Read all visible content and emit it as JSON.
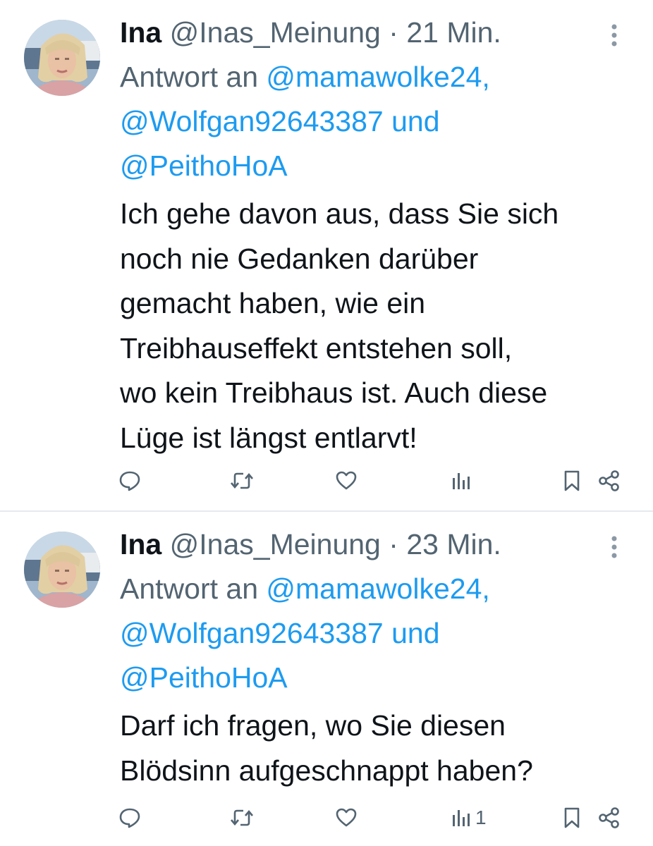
{
  "tweets": [
    {
      "name": "Ina",
      "handle": "@Inas_Meinung",
      "separator": "·",
      "time": "21 Min.",
      "reply_prefix": "Antwort an",
      "mention_1": "@mamawolke24,",
      "mention_2": "@Wolfgan92643387",
      "reply_join": "und",
      "mention_3": "@PeithoHoA",
      "text_lines": [
        "Ich gehe davon aus, dass Sie sich",
        "noch nie Gedanken darüber",
        "gemacht haben, wie ein",
        "Treibhauseffekt entstehen soll,",
        "wo kein Treibhaus ist. Auch diese",
        "Lüge ist längst entlarvt!"
      ],
      "actions": {
        "reply_icon": "reply-icon",
        "retweet_icon": "retweet-icon",
        "like_icon": "heart-icon",
        "views_icon": "views-icon",
        "views_count": "",
        "bookmark_icon": "bookmark-icon",
        "share_icon": "share-icon"
      }
    },
    {
      "name": "Ina",
      "handle": "@Inas_Meinung",
      "separator": "·",
      "time": "23 Min.",
      "reply_prefix": "Antwort an",
      "mention_1": "@mamawolke24,",
      "mention_2": "@Wolfgan92643387",
      "reply_join": "und",
      "mention_3": "@PeithoHoA",
      "text_lines": [
        "Darf ich fragen, wo Sie diesen",
        "Blödsinn aufgeschnappt haben?"
      ],
      "actions": {
        "reply_icon": "reply-icon",
        "retweet_icon": "retweet-icon",
        "like_icon": "heart-icon",
        "views_icon": "views-icon",
        "views_count": "1",
        "bookmark_icon": "bookmark-icon",
        "share_icon": "share-icon"
      }
    }
  ],
  "colors": {
    "text": "#0f1419",
    "secondary": "#536471",
    "link": "#1d9bf0",
    "divider": "#e6e9ec"
  }
}
